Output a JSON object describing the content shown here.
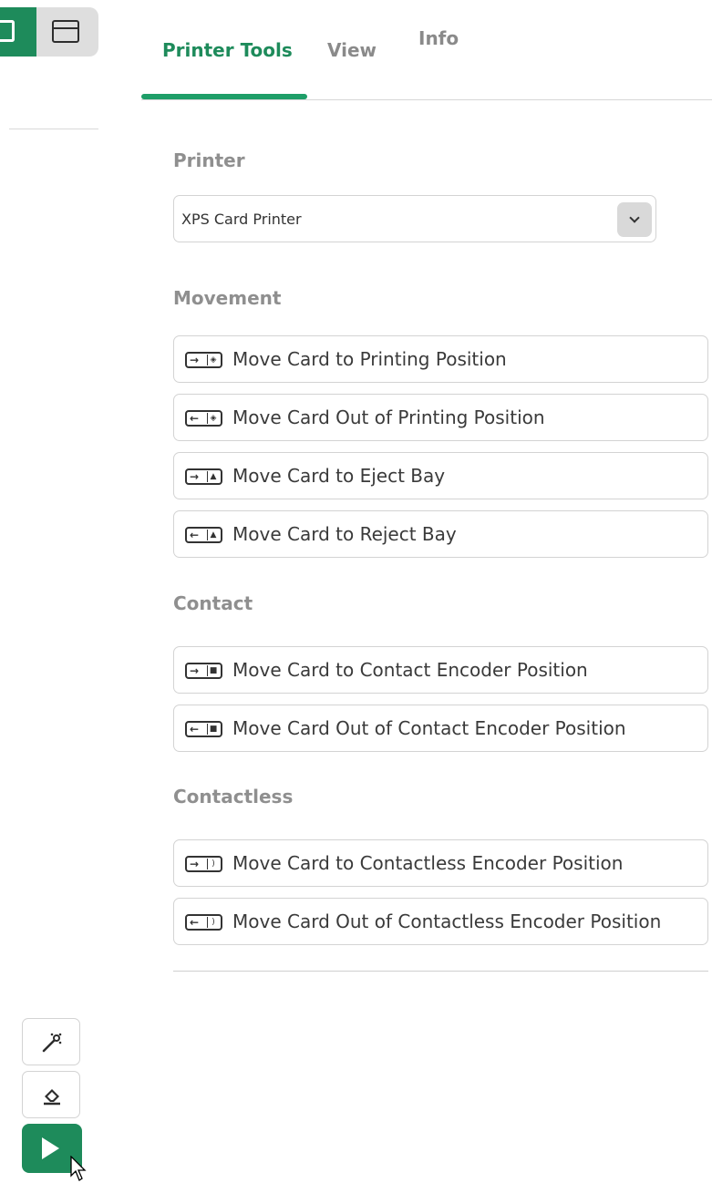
{
  "view_toggle": {
    "active_icon": "panel-icon",
    "inactive_icon": "window-icon"
  },
  "tabs": [
    {
      "label": "Printer Tools",
      "active": true
    },
    {
      "label": "View",
      "active": false
    },
    {
      "label": "Info",
      "active": false
    }
  ],
  "printer": {
    "title": "Printer",
    "selected": "XPS Card Printer"
  },
  "movement": {
    "title": "Movement",
    "actions": [
      {
        "label": "Move Card to Printing Position",
        "arrow": "→",
        "end": "◈"
      },
      {
        "label": "Move Card Out of Printing Position",
        "arrow": "←",
        "end": "◈"
      },
      {
        "label": "Move Card to Eject Bay",
        "arrow": "→",
        "end": "▲"
      },
      {
        "label": "Move Card to Reject Bay",
        "arrow": "←",
        "end": "▲"
      }
    ]
  },
  "contact": {
    "title": "Contact",
    "actions": [
      {
        "label": "Move Card to Contact Encoder Position",
        "arrow": "→",
        "end": "■"
      },
      {
        "label": "Move Card Out of Contact Encoder Position",
        "arrow": "←",
        "end": "■"
      }
    ]
  },
  "contactless": {
    "title": "Contactless",
    "actions": [
      {
        "label": "Move Card to Contactless Encoder Position",
        "arrow": "→",
        "end": ")"
      },
      {
        "label": "Move Card Out of Contactless Encoder Position",
        "arrow": "←",
        "end": ")"
      }
    ]
  },
  "tools": {
    "wand_icon": "magic-wand-icon",
    "eraser_icon": "eraser-icon",
    "play_icon": "play-icon"
  },
  "colors": {
    "accent": "#1e8b5b",
    "tab_underline": "#1e9e68",
    "section_title": "#8f8f8f"
  }
}
